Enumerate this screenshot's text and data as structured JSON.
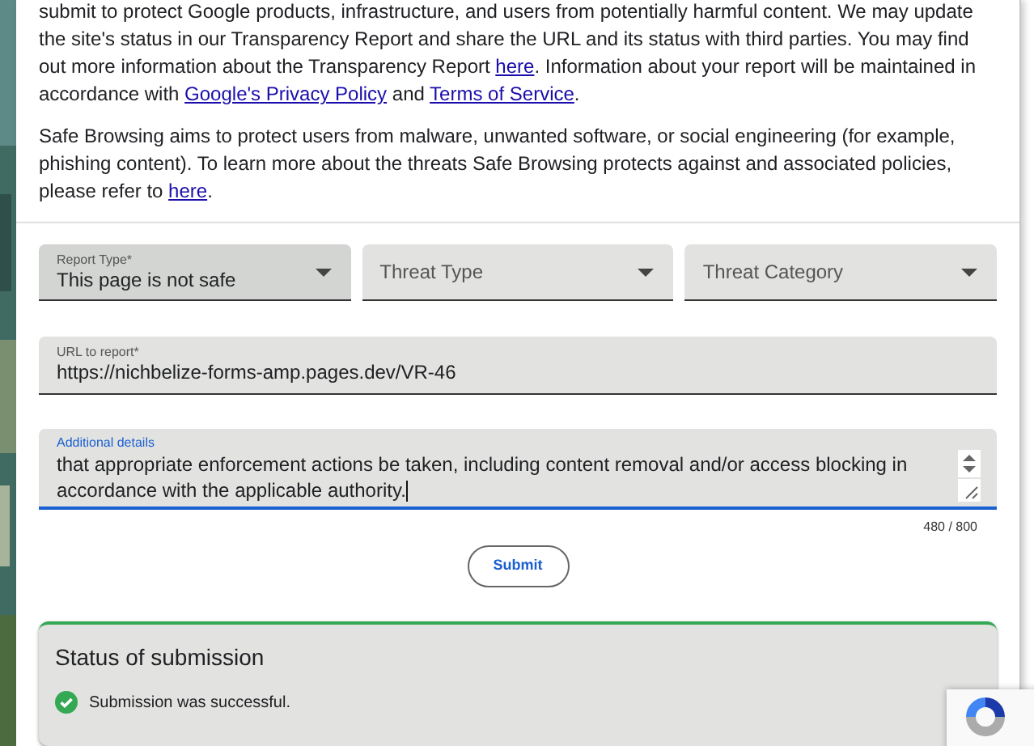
{
  "paragraphs": [
    [
      {
        "kind": "text",
        "text": "submit to protect Google products, infrastructure, and users from potentially harmful content. We may update the site's status in our Transparency Report and share the URL and its status with third parties. You may find out more information about the Transparency Report "
      },
      {
        "kind": "link",
        "text": "here"
      },
      {
        "kind": "text",
        "text": ". Information about your report will be maintained in accordance with "
      },
      {
        "kind": "link",
        "text": "Google's Privacy Policy"
      },
      {
        "kind": "text",
        "text": " and "
      },
      {
        "kind": "link",
        "text": "Terms of Service"
      },
      {
        "kind": "text",
        "text": "."
      }
    ],
    [
      {
        "kind": "text",
        "text": "Safe Browsing aims to protect users from malware, unwanted software, or social engineering (for example, phishing content). To learn more about the threats Safe Browsing protects against and associated policies, please refer to "
      },
      {
        "kind": "link",
        "text": "here"
      },
      {
        "kind": "text",
        "text": "."
      }
    ]
  ],
  "dropdowns": [
    {
      "label": "Report Type*",
      "value": "This page is not safe",
      "selected": true
    },
    {
      "placeholder": "Threat Type",
      "selected": false
    },
    {
      "placeholder": "Threat Category",
      "selected": false
    }
  ],
  "url_field": {
    "label": "URL to report*",
    "value": "https://nichbelize-forms-amp.pages.dev/VR-46"
  },
  "details_field": {
    "label": "Additional details",
    "value": "that appropriate enforcement actions be taken, including content removal and/or access blocking in accordance with the applicable authority.",
    "focused": true,
    "counter": "480 / 800"
  },
  "submit": "Submit",
  "status": {
    "title": "Status of submission",
    "message": "Submission was successful."
  }
}
